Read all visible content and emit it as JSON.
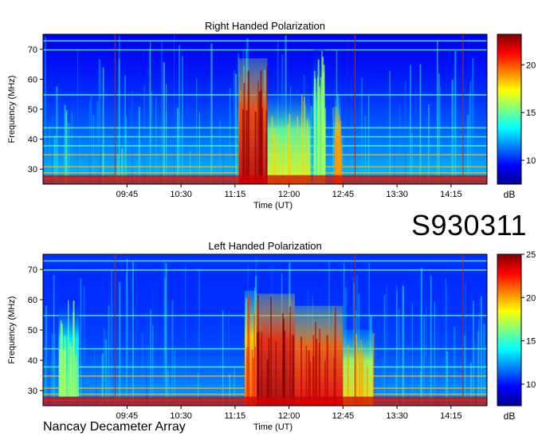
{
  "figure": {
    "station_label": "S930311",
    "footer_label": "Nancay Decameter Array"
  },
  "palette": [
    "#00008f",
    "#0000ff",
    "#0080ff",
    "#00ffff",
    "#80ff80",
    "#ffff00",
    "#ff8000",
    "#ff0000",
    "#800000"
  ],
  "chart_data": [
    {
      "type": "heatmap",
      "title": "Right Handed Polarization",
      "xlabel": "Time (UT)",
      "ylabel": "Frequency (MHz)",
      "x_ticks": [
        "09:45",
        "10:30",
        "11:15",
        "12:00",
        "12:45",
        "13:30",
        "14:15"
      ],
      "x_tick_minutes": [
        585,
        630,
        675,
        720,
        765,
        810,
        855
      ],
      "x_range_minutes": [
        515,
        885
      ],
      "y_ticks": [
        30,
        40,
        50,
        60,
        70
      ],
      "ylim": [
        25,
        75
      ],
      "colorbar": {
        "unit": "dB",
        "ticks": [
          10,
          15,
          20
        ],
        "range": [
          7.5,
          23.2
        ]
      },
      "grid_lines_minutes": [
        575,
        775,
        865
      ],
      "bursts": [
        {
          "start_min": 678,
          "end_min": 702,
          "f_low": 25,
          "f_high": 67,
          "level_db": 22
        },
        {
          "start_min": 702,
          "end_min": 738,
          "f_low": 25,
          "f_high": 55,
          "level_db": 17
        },
        {
          "start_min": 740,
          "end_min": 750,
          "f_low": 25,
          "f_high": 70,
          "level_db": 15
        },
        {
          "start_min": 758,
          "end_min": 763,
          "f_low": 25,
          "f_high": 54,
          "level_db": 18
        }
      ],
      "rfi_bands_mhz": [
        27,
        29,
        31,
        35,
        38,
        41,
        44,
        55,
        70,
        73
      ]
    },
    {
      "type": "heatmap",
      "title": "Left Handed Polarization",
      "xlabel": "Time (UT)",
      "ylabel": "Frequency (MHz)",
      "x_ticks": [
        "09:45",
        "10:30",
        "11:15",
        "12:00",
        "12:45",
        "13:30",
        "14:15"
      ],
      "x_tick_minutes": [
        585,
        630,
        675,
        720,
        765,
        810,
        855
      ],
      "x_range_minutes": [
        515,
        885
      ],
      "y_ticks": [
        30,
        40,
        50,
        60,
        70
      ],
      "ylim": [
        25,
        75
      ],
      "colorbar": {
        "unit": "dB",
        "ticks": [
          10,
          15,
          20,
          25
        ],
        "range": [
          7.5,
          25
        ]
      },
      "grid_lines_minutes": [
        575,
        775,
        865
      ],
      "bursts": [
        {
          "start_min": 683,
          "end_min": 693,
          "f_low": 25,
          "f_high": 63,
          "level_db": 21
        },
        {
          "start_min": 693,
          "end_min": 725,
          "f_low": 25,
          "f_high": 62,
          "level_db": 24
        },
        {
          "start_min": 725,
          "end_min": 765,
          "f_low": 25,
          "f_high": 58,
          "level_db": 23
        },
        {
          "start_min": 765,
          "end_min": 790,
          "f_low": 25,
          "f_high": 50,
          "level_db": 19
        },
        {
          "start_min": 528,
          "end_min": 545,
          "f_low": 28,
          "f_high": 60,
          "level_db": 16
        }
      ],
      "rfi_bands_mhz": [
        27,
        29,
        31,
        35,
        38,
        44,
        55,
        70,
        73
      ]
    }
  ]
}
